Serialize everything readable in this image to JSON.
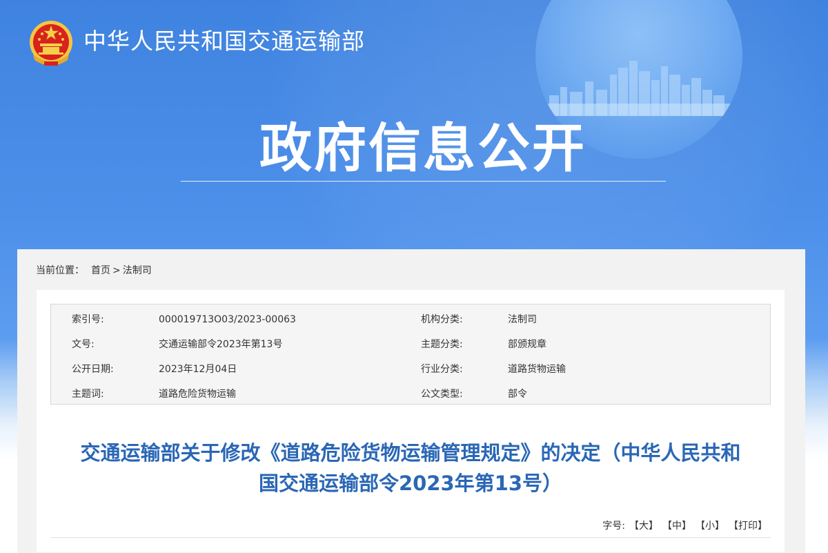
{
  "header": {
    "ministry_name": "中华人民共和国交通运输部",
    "section_title": "政府信息公开",
    "emblem_icon": "national-emblem-icon"
  },
  "breadcrumb": {
    "label": "当前位置：",
    "home": "首页",
    "separator": ">",
    "current": "法制司"
  },
  "metadata": {
    "rows": [
      {
        "left_label": "索引号:",
        "left_value": "000019713O03/2023-00063",
        "right_label": "机构分类:",
        "right_value": "法制司"
      },
      {
        "left_label": "文号:",
        "left_value": "交通运输部令2023年第13号",
        "right_label": "主题分类:",
        "right_value": "部颁规章"
      },
      {
        "left_label": "公开日期:",
        "left_value": "2023年12月04日",
        "right_label": "行业分类:",
        "right_value": "道路货物运输"
      },
      {
        "left_label": "主题词:",
        "left_value": "道路危险货物运输",
        "right_label": "公文类型:",
        "right_value": "部令"
      }
    ]
  },
  "document": {
    "title_line1": "交通运输部关于修改《道路危险货物运输管理规定》的决定（中华人民共和",
    "title_line2": "国交通运输部令2023年第13号）"
  },
  "font_tools": {
    "label": "字号:",
    "large": "【大】",
    "medium": "【中】",
    "small": "【小】",
    "print": "【打印】"
  },
  "colors": {
    "banner_blue": "#4d90ea",
    "title_blue": "#2a67b5"
  }
}
